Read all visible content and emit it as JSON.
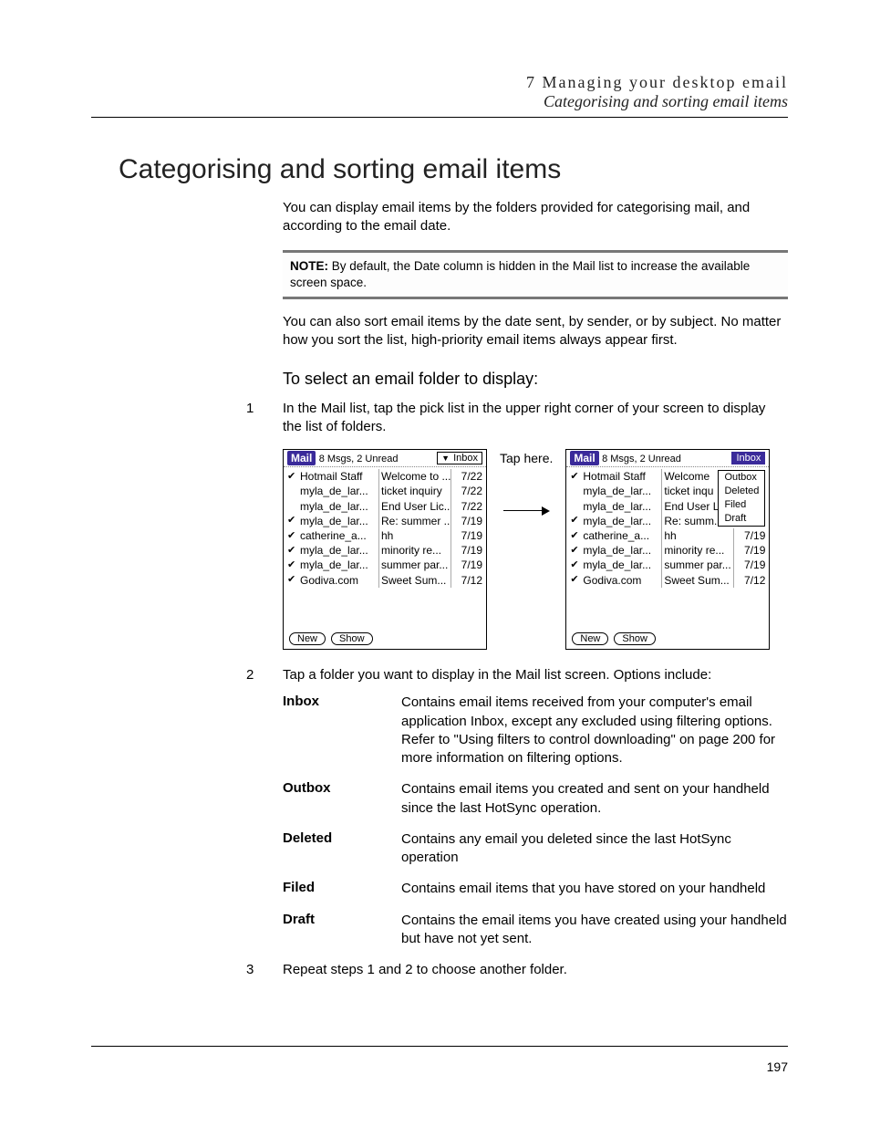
{
  "header": {
    "chapter": "7 Managing your desktop email",
    "subtitle": "Categorising and sorting email items"
  },
  "title": "Categorising and sorting email items",
  "intro1": "You can display email items by the folders provided for categorising mail, and according to the email date.",
  "note": {
    "label": "NOTE:",
    "text": "By default, the Date column is hidden in the Mail list to increase the available screen space."
  },
  "intro2": "You can also sort email items by the date sent, by sender, or by subject. No matter how you sort the list, high-priority email items always appear first.",
  "subhead": "To select an email folder to display:",
  "steps": {
    "s1": {
      "n": "1",
      "text": "In the Mail list, tap the pick list in the upper right corner of your screen to display the list of folders."
    },
    "s2": {
      "n": "2",
      "text": "Tap a folder you want to display in the Mail list screen. Options include:"
    },
    "s3": {
      "n": "3",
      "text": "Repeat steps 1 and 2 to choose another folder."
    }
  },
  "tap_here": "Tap here.",
  "screen": {
    "app": "Mail",
    "meta": "8 Msgs, 2 Unread",
    "picklist": "Inbox",
    "rows": [
      {
        "chk": "✔",
        "from": "Hotmail Staff",
        "subj": "Welcome to ...",
        "subj2": "Welcome",
        "date": "7/22"
      },
      {
        "chk": "",
        "from": "myla_de_lar...",
        "subj": "ticket inquiry",
        "subj2": "ticket inqu",
        "date": "7/22"
      },
      {
        "chk": "",
        "from": "myla_de_lar...",
        "subj": "End User Lic...",
        "subj2": "End User L",
        "date": "7/22"
      },
      {
        "chk": "✔",
        "from": "myla_de_lar...",
        "subj": "Re: summer ...",
        "subj2": "Re: summ...",
        "date": "7/19"
      },
      {
        "chk": "✔",
        "from": "catherine_a...",
        "subj": "hh",
        "subj2": "hh",
        "date": "7/19"
      },
      {
        "chk": "✔",
        "from": "myla_de_lar...",
        "subj": "minority re...",
        "subj2": "minority re...",
        "date": "7/19"
      },
      {
        "chk": "✔",
        "from": "myla_de_lar...",
        "subj": "summer par...",
        "subj2": "summer par...",
        "date": "7/19"
      },
      {
        "chk": "✔",
        "from": "Godiva.com",
        "subj": "Sweet Sum...",
        "subj2": "Sweet Sum...",
        "date": "7/12"
      }
    ],
    "btn_new": "New",
    "btn_show": "Show",
    "dropdown": [
      "Outbox",
      "Deleted",
      "Filed",
      "Draft"
    ]
  },
  "definitions": [
    {
      "term": "Inbox",
      "desc": "Contains email items received from your computer's email application Inbox, except any excluded using filtering options. Refer to \"Using filters to control downloading\" on page 200 for more information on filtering options."
    },
    {
      "term": "Outbox",
      "desc": "Contains email items you created and sent on your handheld since the last HotSync operation."
    },
    {
      "term": "Deleted",
      "desc": "Contains any email you deleted since the last HotSync operation"
    },
    {
      "term": "Filed",
      "desc": "Contains email items that you have stored on your handheld"
    },
    {
      "term": "Draft",
      "desc": "Contains the email items you have created using your handheld but have not yet sent."
    }
  ],
  "page_number": "197"
}
